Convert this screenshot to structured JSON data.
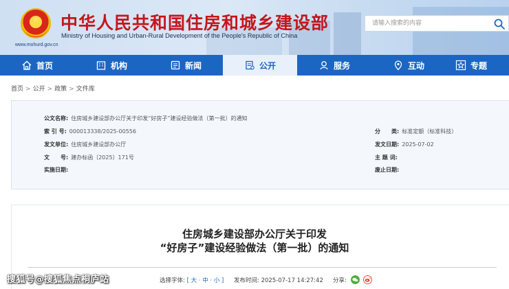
{
  "header": {
    "title_cn": "中华人民共和国住房和城乡建设部",
    "title_en": "Ministry of Housing and Urban-Rural Development of the People's Republic of China",
    "site_url": "www.mohurd.gov.cn",
    "search_placeholder": "请输入搜索的内容"
  },
  "nav": {
    "items": [
      {
        "label": "首页",
        "icon": "home-icon"
      },
      {
        "label": "机构",
        "icon": "building-icon"
      },
      {
        "label": "新闻",
        "icon": "news-icon"
      },
      {
        "label": "公开",
        "icon": "document-icon"
      },
      {
        "label": "服务",
        "icon": "service-icon"
      },
      {
        "label": "互动",
        "icon": "location-icon"
      },
      {
        "label": "专题",
        "icon": "star-icon"
      }
    ],
    "active_color": "#1c66c3"
  },
  "breadcrumb": [
    "首页",
    "公开",
    "政策",
    "文件库"
  ],
  "meta": {
    "name_label": "公文名称:",
    "name_value": "住房城乡建设部办公厅关于印发“好房子”建设经验做法（第一批）的通知",
    "index_label": "索 引 号:",
    "index_value": "000013338/2025-00556",
    "category_label": "分　　类:",
    "category_value": "标准定额（标准科技）",
    "issuer_label": "发文单位:",
    "issuer_value": "住房城乡建设部办公厅",
    "date_label": "发文日期:",
    "date_value": "2025-07-02",
    "docno_label": "文　　号:",
    "docno_value": "建办标函〔2025〕171号",
    "keywords_label": "主 题 词:",
    "keywords_value": "",
    "effective_label": "实施日期:",
    "effective_value": "",
    "expire_label": "废止日期:",
    "expire_value": ""
  },
  "article": {
    "title_line1": "住房城乡建设部办公厅关于印发",
    "title_line2": "“好房子”建设经验做法（第一批）的通知",
    "font_select_label": "选择字体:",
    "font_options": "[ 大 · 中 · 小 ]",
    "publish_label": "发布时间:",
    "publish_time": "2025-07-17 14:27:42",
    "share_label": "分享:"
  },
  "watermark": "搜狐号@搜狐焦点桐庐站"
}
